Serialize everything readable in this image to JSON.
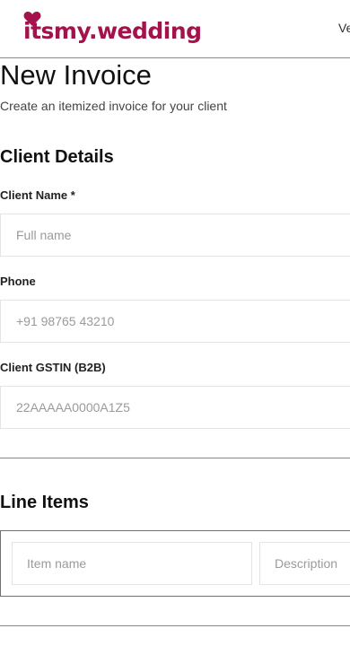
{
  "brand": {
    "name": "itsmy.wedding",
    "color": "#a3124a",
    "icon": "heart-icon"
  },
  "header": {
    "nav_text": "Ve"
  },
  "page": {
    "title": "New Invoice",
    "subtitle": "Create an itemized invoice for your client"
  },
  "client_details": {
    "title": "Client Details",
    "client_name": {
      "label": "Client Name *",
      "value": "",
      "placeholder": "Full name"
    },
    "phone": {
      "label": "Phone",
      "value": "",
      "placeholder": "+91 98765 43210"
    },
    "gstin": {
      "label": "Client GSTIN (B2B)",
      "value": "",
      "placeholder": "22AAAAA0000A1Z5"
    }
  },
  "line_items": {
    "title": "Line Items",
    "item_name": {
      "value": "",
      "placeholder": "Item name"
    },
    "description": {
      "value": "",
      "placeholder": "Description"
    }
  }
}
